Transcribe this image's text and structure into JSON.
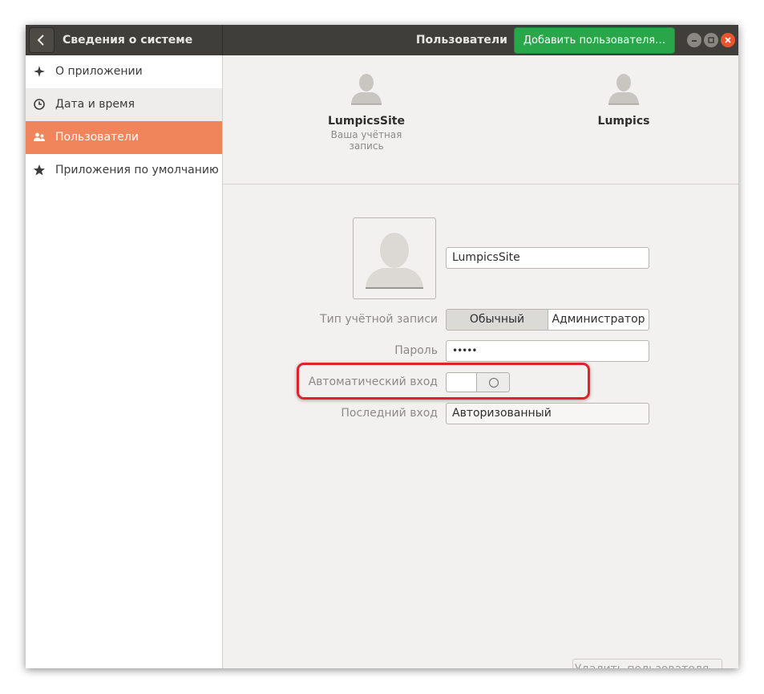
{
  "header": {
    "back_icon": "chevron-left-icon",
    "title": "Сведения о системе",
    "section_title": "Пользователи",
    "add_user_button": "Добавить пользователя…",
    "window_controls": [
      "minimize-icon",
      "maximize-icon",
      "close-icon"
    ],
    "accent_color": "#2aa64a"
  },
  "sidebar": {
    "items": [
      {
        "label": "О приложении",
        "icon": "sparkle-icon",
        "state": "normal"
      },
      {
        "label": "Дата и время",
        "icon": "clock-icon",
        "state": "hover"
      },
      {
        "label": "Пользователи",
        "icon": "users-icon",
        "state": "selected"
      },
      {
        "label": "Приложения по умолчанию",
        "icon": "star-icon",
        "state": "normal"
      }
    ],
    "selected_color": "#f0845b"
  },
  "accounts": [
    {
      "name": "LumpicsSite",
      "subtitle": "Ваша учётная запись"
    },
    {
      "name": "Lumpics",
      "subtitle": ""
    }
  ],
  "details": {
    "username_value": "LumpicsSite",
    "account_type_label": "Тип учётной записи",
    "account_type_options": [
      "Обычный",
      "Администратор"
    ],
    "account_type_selected": "Обычный",
    "password_label": "Пароль",
    "password_value": "•••••",
    "autologin_label": "Автоматический вход",
    "autologin_enabled": false,
    "last_login_label": "Последний вход",
    "last_login_value": "Авторизованный",
    "highlight_color": "#e0232a"
  },
  "footer": {
    "delete_user_button": "Удалить пользователя…"
  }
}
